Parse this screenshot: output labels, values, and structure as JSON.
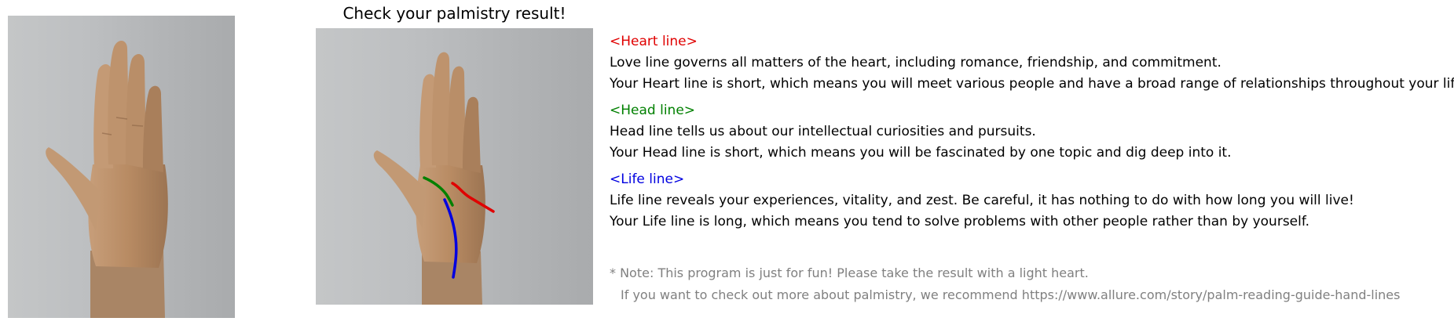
{
  "title": "Check your palmistry result!",
  "lines": [
    {
      "header": "<Heart line>",
      "color": "#e00000",
      "description": "Love line governs all matters of the heart, including romance, friendship, and commitment.",
      "result": "Your Heart line is short, which means you will meet various people and have a broad range of relationships throughout your life."
    },
    {
      "header": "<Head line>",
      "color": "#008000",
      "description": "Head line tells us about our intellectual curiosities and pursuits.",
      "result": "Your Head line is short, which means you will be fascinated by one topic and dig deep into it."
    },
    {
      "header": "<Life line>",
      "color": "#0000e0",
      "description": "Life line reveals your experiences, vitality, and zest. Be careful, it has nothing to do with how long you will live!",
      "result": "Your Life line is long, which means you tend to solve problems with other people rather than by yourself."
    }
  ],
  "note": {
    "line1": "* Note: This program is just for fun! Please take the result with a light heart.",
    "line2": "If you want to check out more about palmistry, we recommend https://www.allure.com/story/palm-reading-guide-hand-lines"
  }
}
